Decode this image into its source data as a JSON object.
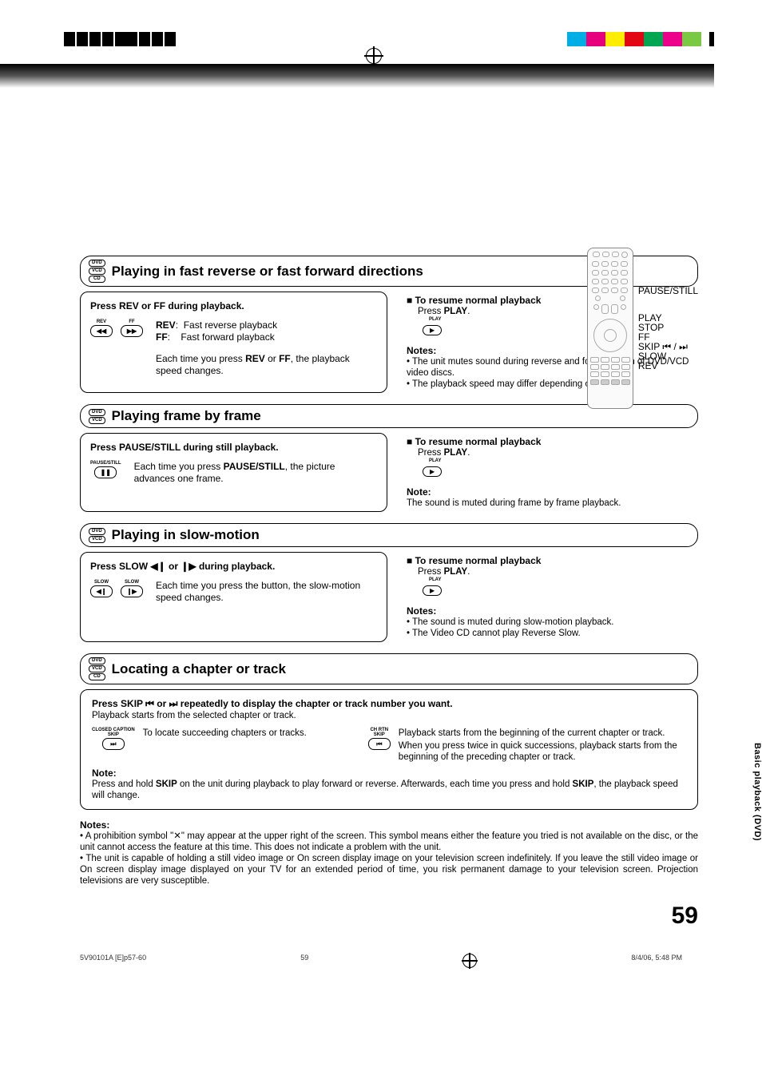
{
  "top_swatch_colors": [
    "#00aee6",
    "#e6007e",
    "#ffed00",
    "#e30613",
    "#00a651",
    "#ec008c",
    "#7ac943"
  ],
  "remote_labels": {
    "pause": "PAUSE/STILL",
    "play": "PLAY",
    "stop": "STOP",
    "ff": "FF",
    "skip": "SKIP ⏮ / ⏭",
    "slow": "SLOW",
    "rev": "REV"
  },
  "section1": {
    "badges": [
      "DVD",
      "VCD",
      "CD"
    ],
    "title": "Playing in fast reverse or fast forward directions",
    "left_instr": "Press REV or FF during playback.",
    "rev_label": "REV",
    "ff_label": "FF",
    "rev_desc": "REV:  Fast reverse playback",
    "ff_desc": "FF:    Fast forward playback",
    "para": "Each time you press REV or FF, the playback speed changes.",
    "right_head": "To resume normal playback",
    "right_press": "Press PLAY.",
    "notes_head": "Notes:",
    "note1": "• The unit mutes sound during reverse and forward scan of DVD/VCD video discs.",
    "note2": "• The playback speed may differ depending on the disc."
  },
  "section2": {
    "badges": [
      "DVD",
      "VCD"
    ],
    "title": "Playing frame by frame",
    "left_instr": "Press PAUSE/STILL during still playback.",
    "btn_label": "PAUSE/STILL",
    "para": "Each time you press PAUSE/STILL, the picture advances one frame.",
    "right_head": "To resume normal playback",
    "right_press": "Press PLAY.",
    "notes_head": "Note:",
    "note1": "The sound is muted during frame by frame playback."
  },
  "section3": {
    "badges": [
      "DVD",
      "VCD"
    ],
    "title": "Playing in slow-motion",
    "left_instr": "Press SLOW ◀❙ or ❙▶ during playback.",
    "slow_l": "SLOW",
    "slow_r": "SLOW",
    "para": "Each time you press the button, the slow-motion speed changes.",
    "right_head": "To resume normal playback",
    "right_press": "Press PLAY.",
    "notes_head": "Notes:",
    "note1": "• The sound is muted during slow-motion playback.",
    "note2": "• The Video CD cannot play Reverse Slow."
  },
  "section4": {
    "badges": [
      "DVD",
      "VCD",
      "CD"
    ],
    "title": "Locating a chapter or track",
    "instr": "Press SKIP ⏮ or ⏭ repeatedly to display the chapter or track number you want.",
    "sub": "Playback starts from the selected chapter or track.",
    "left_btn": "CLOSED CAPTION\nSKIP",
    "left_desc": "To locate succeeding chapters or tracks.",
    "right_btn": "CH RTN\nSKIP",
    "right_desc1": "Playback starts from the beginning of the current chapter or track.",
    "right_desc2": "When you press twice in quick successions, playback starts from the beginning of the preceding chapter or track.",
    "note_head": "Note:",
    "note_text": "Press and hold SKIP on the unit during playback to play forward or reverse. Afterwards, each time you press and hold SKIP, the playback speed will change."
  },
  "footer_notes": {
    "head": "Notes:",
    "n1": "• A prohibition symbol \"✕\" may appear at the upper right of the screen. This symbol means either the feature you tried is not available on the disc, or the unit cannot access the feature at this time. This does not indicate a problem with the unit.",
    "n2": "• The unit is capable of holding a still video image or On screen display image on your television screen indefinitely. If you leave the still video image or On screen display image displayed on your TV for an extended period of time, you risk permanent damage to your television screen. Projection televisions are very susceptible."
  },
  "side_tab": "Basic playback (DVD)",
  "page_number": "59",
  "footer": {
    "left": "5V90101A [E]p57-60",
    "mid": "59",
    "right": "8/4/06, 5:48 PM"
  },
  "play_btn_text": "PLAY"
}
